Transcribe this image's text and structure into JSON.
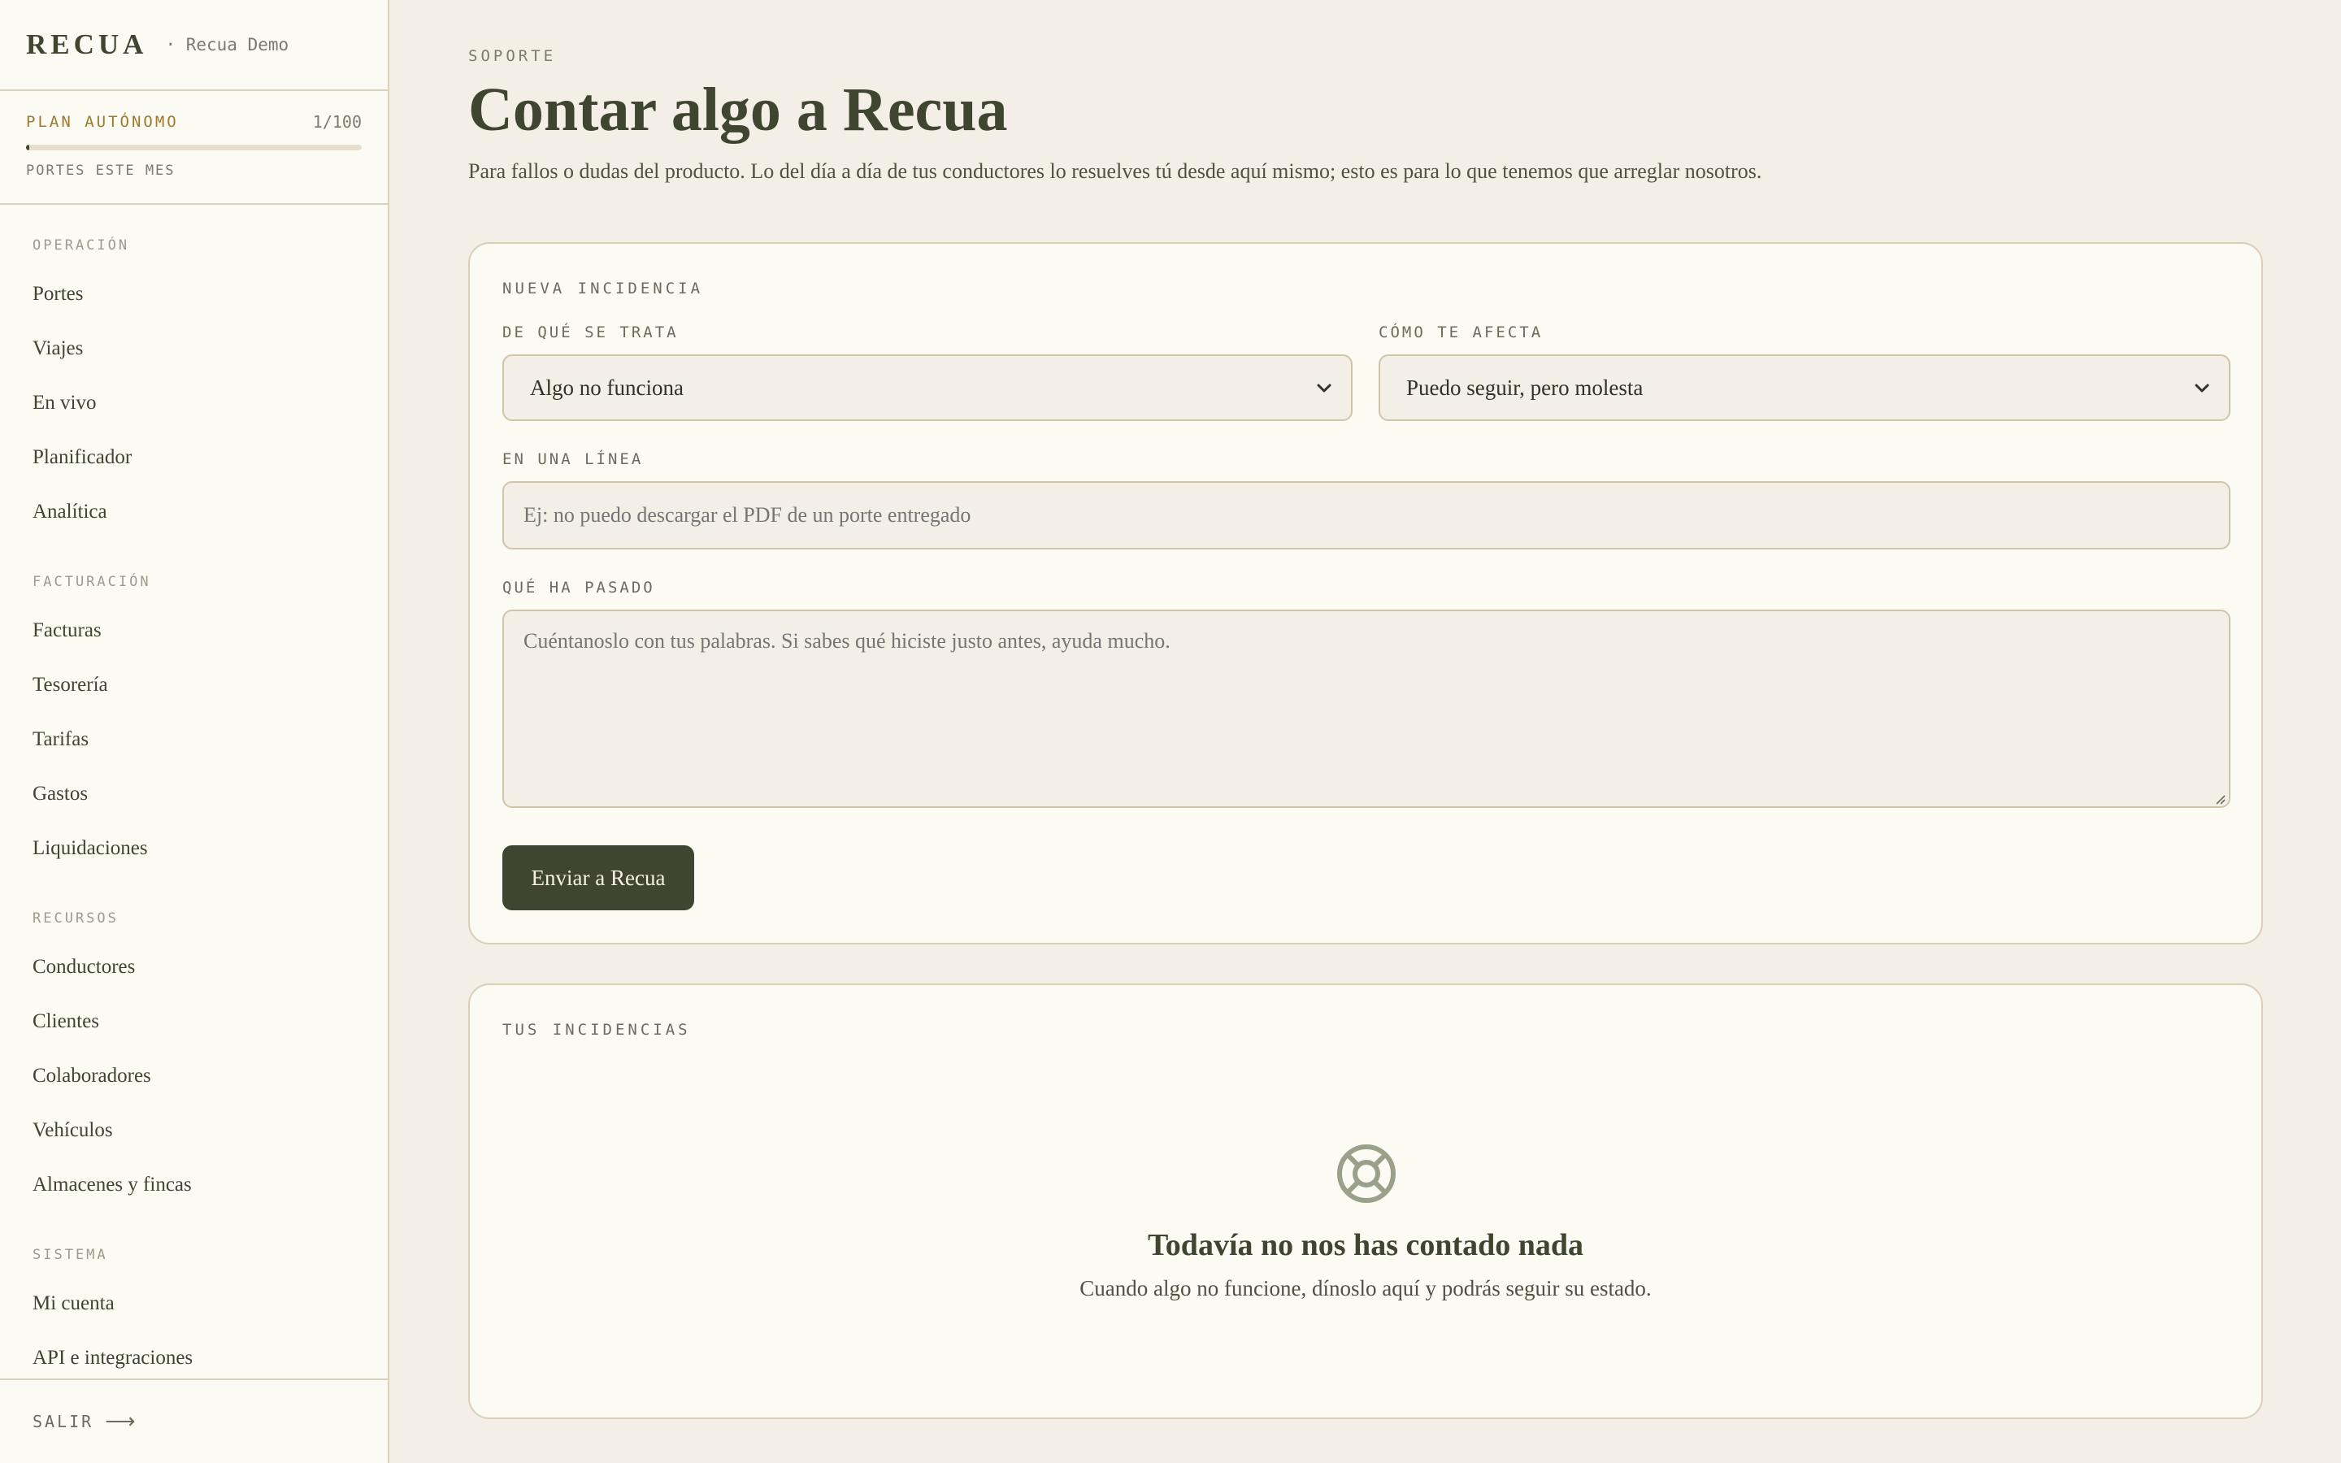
{
  "brand": {
    "logo": "RECUA",
    "workspace": "· Recua Demo"
  },
  "plan": {
    "name": "PLAN AUTÓNOMO",
    "count": "1/100",
    "usage_fraction": 0.01,
    "label": "PORTES ESTE MES"
  },
  "sidebar": {
    "sections": [
      {
        "heading": "OPERACIÓN",
        "items": [
          "Portes",
          "Viajes",
          "En vivo",
          "Planificador",
          "Analítica"
        ]
      },
      {
        "heading": "FACTURACIÓN",
        "items": [
          "Facturas",
          "Tesorería",
          "Tarifas",
          "Gastos",
          "Liquidaciones"
        ]
      },
      {
        "heading": "RECURSOS",
        "items": [
          "Conductores",
          "Clientes",
          "Colaboradores",
          "Vehículos",
          "Almacenes y fincas"
        ]
      },
      {
        "heading": "SISTEMA",
        "items": [
          "Mi cuenta",
          "API e integraciones"
        ]
      }
    ],
    "logout": "SALIR",
    "logout_icon": "arrow-right-icon"
  },
  "header": {
    "eyebrow": "SOPORTE",
    "title": "Contar algo a Recua",
    "description": "Para fallos o dudas del producto. Lo del día a día de tus conductores lo resuelves tú desde aquí mismo; esto es para lo que tenemos que arreglar nosotros."
  },
  "form": {
    "heading": "NUEVA INCIDENCIA",
    "type_label": "DE QUÉ SE TRATA",
    "type_value": "Algo no funciona",
    "impact_label": "CÓMO TE AFECTA",
    "impact_value": "Puedo seguir, pero molesta",
    "summary_label": "EN UNA LÍNEA",
    "summary_placeholder": "Ej: no puedo descargar el PDF de un porte entregado",
    "details_label": "QUÉ HA PASADO",
    "details_placeholder": "Cuéntanoslo con tus palabras. Si sabes qué hiciste justo antes, ayuda mucho.",
    "submit": "Enviar a Recua"
  },
  "incidents": {
    "heading": "TUS INCIDENCIAS",
    "empty_icon": "lifebuoy-icon",
    "empty_title": "Todavía no nos has contado nada",
    "empty_desc": "Cuando algo no funcione, dínoslo aquí y podrás seguir su estado."
  },
  "colors": {
    "accent": "#3f4530",
    "plan": "#a07a2c",
    "background": "#f3efe7",
    "card": "#fbfaf3"
  }
}
